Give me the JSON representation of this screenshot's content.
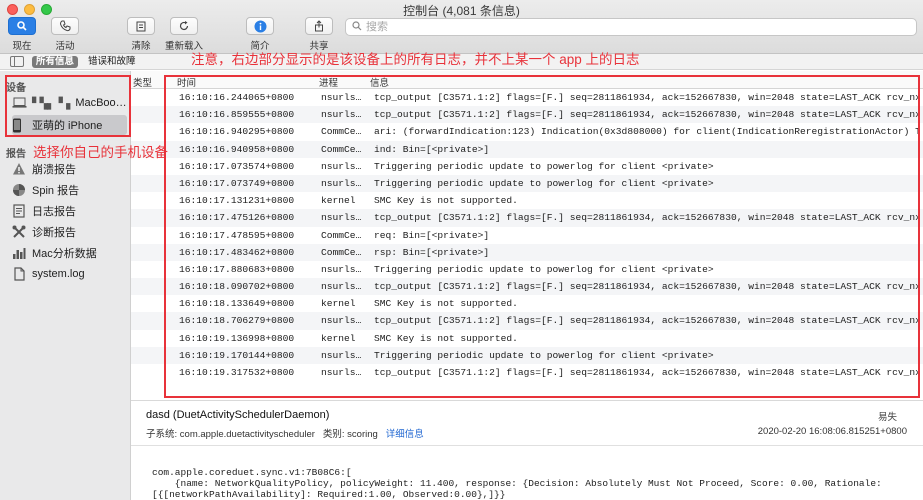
{
  "window": {
    "title": "控制台 (4,081 条信息)"
  },
  "toolbar": {
    "now_label": "现在",
    "activity_label": "活动",
    "clear_label": "清除",
    "reload_label": "重新载入",
    "info_label": "简介",
    "share_label": "共享",
    "search_placeholder": "搜索"
  },
  "filterbar": {
    "all_messages": "所有信息",
    "errors_faults": "错误和故障"
  },
  "sidebar": {
    "devices_header": "设备",
    "devices": [
      {
        "label": "    的 MacBoo…",
        "shown": "MacBoo…"
      },
      {
        "label": "亚萌的 iPhone"
      }
    ],
    "reports_header": "报告",
    "reports": [
      {
        "label": "崩溃报告"
      },
      {
        "label": "Spin 报告"
      },
      {
        "label": "日志报告"
      },
      {
        "label": "诊断报告"
      },
      {
        "label": "Mac分析数据"
      },
      {
        "label": "system.log"
      }
    ]
  },
  "table": {
    "headers": {
      "type": "类型",
      "time": "时间",
      "process": "进程",
      "message": "信息"
    },
    "rows": [
      {
        "time": "16:10:16.244065+0800",
        "process": "nsurls…",
        "message": "tcp_output [C3571.1:2] flags=[F.] seq=2811861934, ack=152667830, win=2048 state=LAST_ACK rcv_nxt…"
      },
      {
        "time": "16:10:16.859555+0800",
        "process": "nsurls…",
        "message": "tcp_output [C3571.1:2] flags=[F.] seq=2811861934, ack=152667830, win=2048 state=LAST_ACK rcv_nxt…"
      },
      {
        "time": "16:10:16.940295+0800",
        "process": "CommCe…",
        "message": "ari: (forwardIndication:123) Indication(0x3d808000) for client(IndicationReregistrationActor) Ty…"
      },
      {
        "time": "16:10:16.940958+0800",
        "process": "CommCe…",
        "message": "ind: Bin=[<private>]"
      },
      {
        "time": "16:10:17.073574+0800",
        "process": "nsurls…",
        "message": "Triggering periodic update to powerlog for client <private>"
      },
      {
        "time": "16:10:17.073749+0800",
        "process": "nsurls…",
        "message": "Triggering periodic update to powerlog for client <private>"
      },
      {
        "time": "16:10:17.131231+0800",
        "process": "kernel",
        "message": "SMC Key      is not supported."
      },
      {
        "time": "16:10:17.475126+0800",
        "process": "nsurls…",
        "message": "tcp_output [C3571.1:2] flags=[F.] seq=2811861934, ack=152667830, win=2048 state=LAST_ACK rcv_nxt…"
      },
      {
        "time": "16:10:17.478595+0800",
        "process": "CommCe…",
        "message": "req: Bin=[<private>]"
      },
      {
        "time": "16:10:17.483462+0800",
        "process": "CommCe…",
        "message": "rsp: Bin=[<private>]"
      },
      {
        "time": "16:10:17.880683+0800",
        "process": "nsurls…",
        "message": "Triggering periodic update to powerlog for client <private>"
      },
      {
        "time": "16:10:18.090702+0800",
        "process": "nsurls…",
        "message": "tcp_output [C3571.1:2] flags=[F.] seq=2811861934, ack=152667830, win=2048 state=LAST_ACK rcv_nxt…"
      },
      {
        "time": "16:10:18.133649+0800",
        "process": "kernel",
        "message": "SMC Key      is not supported."
      },
      {
        "time": "16:10:18.706279+0800",
        "process": "nsurls…",
        "message": "tcp_output [C3571.1:2] flags=[F.] seq=2811861934, ack=152667830, win=2048 state=LAST_ACK rcv_nxt…"
      },
      {
        "time": "16:10:19.136998+0800",
        "process": "kernel",
        "message": "SMC Key      is not supported."
      },
      {
        "time": "16:10:19.170144+0800",
        "process": "nsurls…",
        "message": "Triggering periodic update to powerlog for client <private>"
      },
      {
        "time": "16:10:19.317532+0800",
        "process": "nsurls…",
        "message": "tcp_output [C3571.1:2] flags=[F.] seq=2811861934, ack=152667830, win=2048 state=LAST_ACK rcv_nxt…"
      }
    ]
  },
  "detail": {
    "title": "dasd (DuetActivitySchedulerDaemon)",
    "level": "易失",
    "subsystem_label": "子系统:",
    "subsystem": "com.apple.duetactivityscheduler",
    "category_label": "类别:",
    "category": "scoring",
    "details_link": "详细信息",
    "timestamp": "2020-02-20 16:08:06.815251+0800",
    "body_line1": "com.apple.coreduet.sync.v1:7B08C6:[",
    "body_line2": "    {name: NetworkQualityPolicy, policyWeight: 11.400, response: {Decision: Absolutely Must Not Proceed, Score: 0.00, Rationale:",
    "body_line3": "[{[networkPathAvailability]: Required:1.00, Observed:0.00},]}}"
  },
  "annotations": {
    "note_top": "注意，右边部分显示的是该设备上的所有日志，并不上某一个 app 上的日志",
    "note_left": "选择你自己的手机设备"
  },
  "colors": {
    "annotation_red": "#e8323a",
    "link_blue": "#1f66d1",
    "info_blue": "#2a7fe5"
  }
}
